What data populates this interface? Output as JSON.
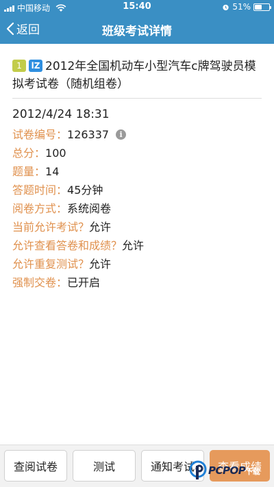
{
  "status_bar": {
    "carrier": "中国移动",
    "time": "15:40",
    "battery": "51%",
    "battery_level": 0.51
  },
  "navbar": {
    "back_label": "返回",
    "title": "班级考试详情"
  },
  "exam": {
    "level_badge": "1",
    "type_badge": "lZ",
    "title": "2012年全国机动车小型汽车c牌驾驶员模拟考试卷（随机组卷）",
    "datetime": "2012/4/24 18:31",
    "fields": [
      {
        "label": "试卷编号：",
        "value": "126337"
      },
      {
        "label": "总分：",
        "value": "100"
      },
      {
        "label": "题量：",
        "value": "14"
      },
      {
        "label": "答题时间：",
        "value": "45分钟"
      },
      {
        "label": "阅卷方式：",
        "value": "系统阅卷"
      },
      {
        "label": "当前允许考试？",
        "value": "允许"
      },
      {
        "label": "允许查看答卷和成绩？",
        "value": "允许"
      },
      {
        "label": "允许重复测试？",
        "value": "允许"
      },
      {
        "label": "强制交卷：",
        "value": "已开启"
      }
    ],
    "info_icon": "i"
  },
  "bottom_bar": {
    "buttons": [
      "查阅试卷",
      "测试",
      "通知考试",
      "查看成绩"
    ]
  },
  "watermark": {
    "text": "PCPOP",
    "suffix": "下载"
  },
  "colors": {
    "header": "#3a8fc4",
    "label": "#e0914e",
    "primary_button": "#e69a5c"
  }
}
